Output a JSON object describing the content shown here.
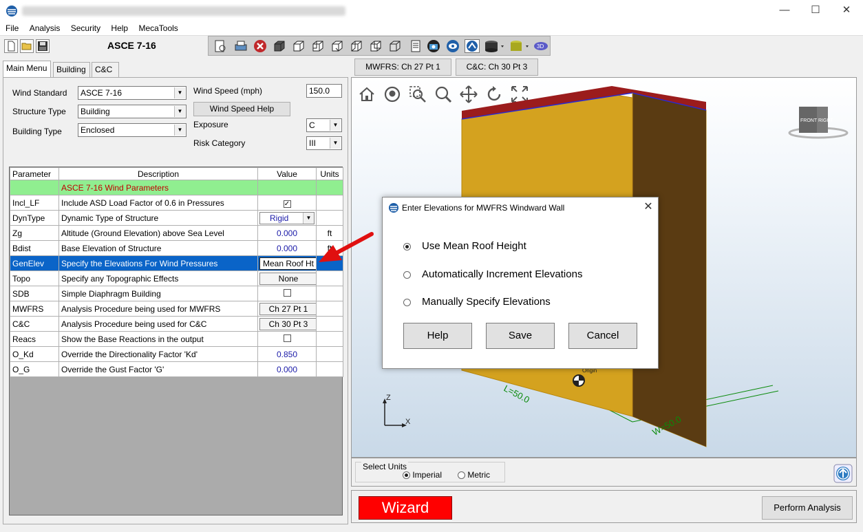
{
  "window": {
    "minimize": "—",
    "maximize": "☐",
    "close": "✕"
  },
  "menu": [
    "File",
    "Analysis",
    "Security",
    "Help",
    "MecaTools"
  ],
  "standard_title": "ASCE 7-16",
  "tabs": [
    "Main Menu",
    "Building",
    "C&C"
  ],
  "top_buttons": {
    "mwfrs": "MWFRS: Ch 27 Pt 1",
    "cc": "C&C: Ch 30 Pt 3"
  },
  "form": {
    "wind_standard_label": "Wind Standard",
    "wind_standard_value": "ASCE 7-16",
    "structure_type_label": "Structure Type",
    "structure_type_value": "Building",
    "building_type_label": "Building Type",
    "building_type_value": "Enclosed",
    "wind_speed_label": "Wind Speed (mph)",
    "wind_speed_value": "150.0",
    "wind_speed_help": "Wind Speed Help",
    "exposure_label": "Exposure",
    "exposure_value": "C",
    "risk_category_label": "Risk Category",
    "risk_category_value": "III"
  },
  "table": {
    "headers": [
      "Parameter",
      "Description",
      "Value",
      "Units"
    ],
    "section_title": "ASCE 7-16 Wind Parameters",
    "rows": [
      {
        "param": "Incl_LF",
        "desc": "Include ASD Load Factor of 0.6 in Pressures",
        "value": "✓",
        "units": ""
      },
      {
        "param": "DynType",
        "desc": "Dynamic Type of Structure",
        "value": "Rigid",
        "units": ""
      },
      {
        "param": "Zg",
        "desc": "Altitude (Ground Elevation) above Sea Level",
        "value": "0.000",
        "units": "ft"
      },
      {
        "param": "Bdist",
        "desc": "Base Elevation of Structure",
        "value": "0.000",
        "units": "ft"
      },
      {
        "param": "GenElev",
        "desc": "Specify the Elevations For Wind Pressures",
        "value": "Mean Roof Ht",
        "units": ""
      },
      {
        "param": "Topo",
        "desc": "Specify any Topographic Effects",
        "value": "None",
        "units": ""
      },
      {
        "param": "SDB",
        "desc": "Simple Diaphragm Building",
        "value": "",
        "units": ""
      },
      {
        "param": "MWFRS",
        "desc": "Analysis Procedure being used for MWFRS",
        "value": "Ch 27 Pt 1",
        "units": ""
      },
      {
        "param": "C&C",
        "desc": "Analysis Procedure being used for C&C",
        "value": "Ch 30 Pt 3",
        "units": ""
      },
      {
        "param": "Reacs",
        "desc": "Show the Base Reactions in the output",
        "value": "",
        "units": ""
      },
      {
        "param": "O_Kd",
        "desc": "Override the Directionality Factor 'Kd'",
        "value": "0.850",
        "units": ""
      },
      {
        "param": "O_G",
        "desc": "Override the Gust Factor 'G'",
        "value": "0.000",
        "units": ""
      }
    ]
  },
  "viewport": {
    "viewcube_front": "FRONT",
    "viewcube_right": "RIGHT",
    "dim_label": "W=50.0",
    "dim_label2": "L=50.0",
    "origin_label": "Origin",
    "axis_z": "Z",
    "axis_x": "X",
    "building_color": "#d4a21f",
    "roof_color": "#9b1c1c"
  },
  "units": {
    "title": "Select Units",
    "imperial": "Imperial",
    "metric": "Metric",
    "selected": "Imperial"
  },
  "bottom": {
    "wizard": "Wizard",
    "perform": "Perform Analysis"
  },
  "dialog": {
    "title": "Enter Elevations for MWFRS Windward Wall",
    "options": [
      "Use Mean Roof Height",
      "Automatically Increment Elevations",
      "Manually Specify Elevations"
    ],
    "selected_option": "Use Mean Roof Height",
    "help": "Help",
    "save": "Save",
    "cancel": "Cancel"
  }
}
